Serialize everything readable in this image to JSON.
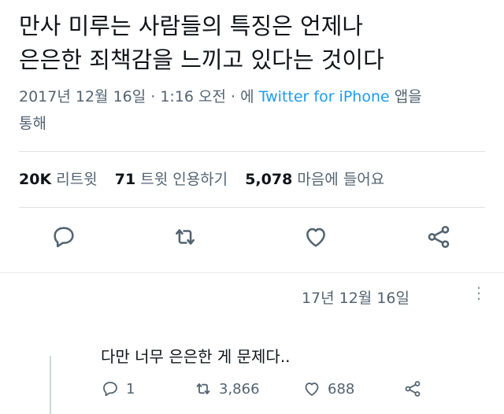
{
  "tweet": {
    "text_line1": "만사 미루는 사람들의 특징은 언제나",
    "text_line2": "은은한 죄책감을 느끼고 있다는 것이다",
    "timestamp": "2017년 12월 16일 · 1:16 오전 · 에",
    "source": "Twitter for iPhone",
    "source_suffix": "앱을",
    "source_suffix2": "통해"
  },
  "stats": {
    "retweets_count": "20K",
    "retweets_label": "리트윗",
    "quotes_count": "71",
    "quotes_label": "트윗 인용하기",
    "likes_count": "5,078",
    "likes_label": "마음에 들어요"
  },
  "icons": [
    "reply-icon",
    "retweet-icon",
    "like-icon",
    "share-icon",
    "more-icon"
  ],
  "reply": {
    "date": "17년 12월 16일",
    "more": "⋮",
    "text": "다만 너무 은은한 게 문제다..",
    "reply_count": "1",
    "retweet_count": "3,866",
    "like_count": "688"
  }
}
